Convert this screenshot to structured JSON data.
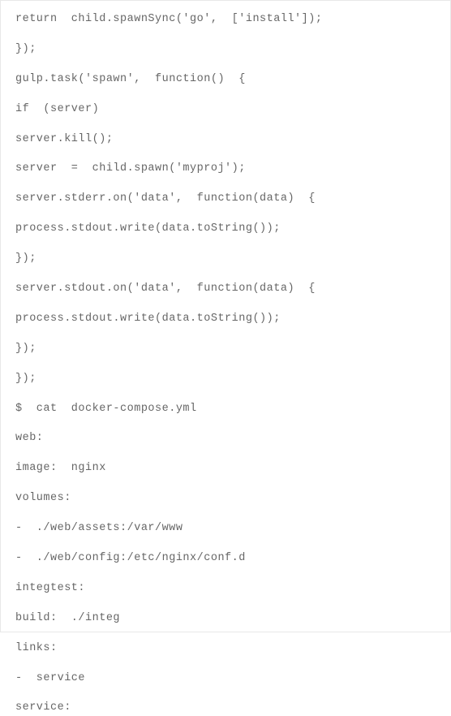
{
  "code_lines": [
    "return  child.spawnSync('go',  ['install']);",
    "});",
    "gulp.task('spawn',  function()  {",
    "if  (server)",
    "server.kill();",
    "server  =  child.spawn('myproj');",
    "server.stderr.on('data',  function(data)  {",
    "process.stdout.write(data.toString());",
    "});",
    "server.stdout.on('data',  function(data)  {",
    "process.stdout.write(data.toString());",
    "});",
    "});",
    "$  cat  docker-compose.yml",
    "web:",
    "image:  nginx",
    "volumes:",
    "-  ./web/assets:/var/www",
    "-  ./web/config:/etc/nginx/conf.d",
    "integtest:",
    "build:  ./integ",
    "links:",
    "-  service",
    "service:"
  ]
}
